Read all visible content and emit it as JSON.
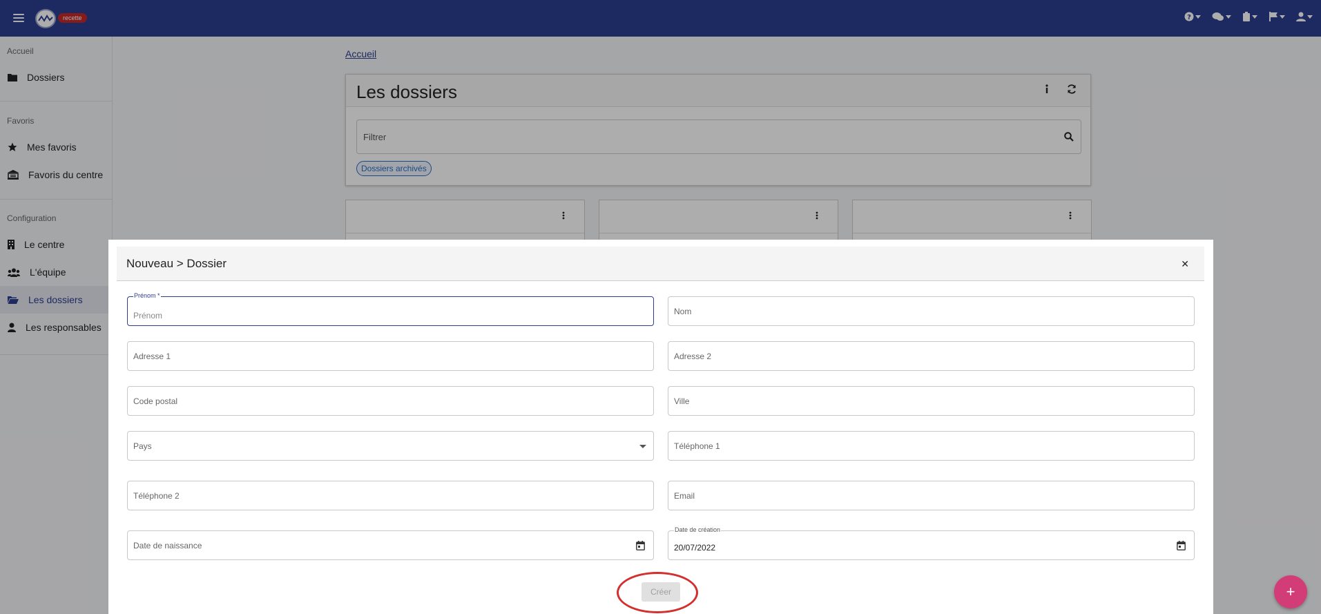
{
  "topbar": {
    "env_badge": "recette",
    "icons": [
      "help-icon",
      "chat-icon",
      "clipboard-icon",
      "flag-icon",
      "user-icon"
    ]
  },
  "sidebar": {
    "sections": [
      {
        "label": "Accueil"
      },
      {
        "label": "Favoris"
      },
      {
        "label": "Configuration"
      }
    ],
    "items": [
      {
        "label": "Dossiers",
        "icon": "folder-icon"
      },
      {
        "label": "Mes favoris",
        "icon": "star-icon"
      },
      {
        "label": "Favoris du centre",
        "icon": "building-icon"
      },
      {
        "label": "Le centre",
        "icon": "office-icon"
      },
      {
        "label": "L'équipe",
        "icon": "team-icon"
      },
      {
        "label": "Les dossiers",
        "icon": "folder-open-icon",
        "active": true
      },
      {
        "label": "Les responsables",
        "icon": "person-icon"
      }
    ]
  },
  "main": {
    "breadcrumb": "Accueil",
    "title": "Les dossiers",
    "filter_placeholder": "Filtrer",
    "chip": "Dossiers archivés"
  },
  "modal": {
    "title": "Nouveau > Dossier",
    "fields": {
      "prenom": {
        "label": "Prénom *",
        "placeholder": "Prénom",
        "value": ""
      },
      "nom": {
        "placeholder": "Nom",
        "value": ""
      },
      "adresse1": {
        "placeholder": "Adresse 1",
        "value": ""
      },
      "adresse2": {
        "placeholder": "Adresse 2",
        "value": ""
      },
      "code_postal": {
        "placeholder": "Code postal",
        "value": ""
      },
      "ville": {
        "placeholder": "Ville",
        "value": ""
      },
      "pays": {
        "placeholder": "Pays",
        "value": ""
      },
      "telephone1": {
        "placeholder": "Téléphone 1",
        "value": ""
      },
      "telephone2": {
        "placeholder": "Téléphone 2",
        "value": ""
      },
      "email": {
        "placeholder": "Email",
        "value": ""
      },
      "date_naissance": {
        "placeholder": "Date de naissance",
        "value": ""
      },
      "date_creation": {
        "label": "Date de création",
        "value": "20/07/2022"
      }
    },
    "create_label": "Créer"
  },
  "colors": {
    "topbar": "#2b3d8f",
    "fab": "#d23c77",
    "annotation": "#d32f2f"
  }
}
